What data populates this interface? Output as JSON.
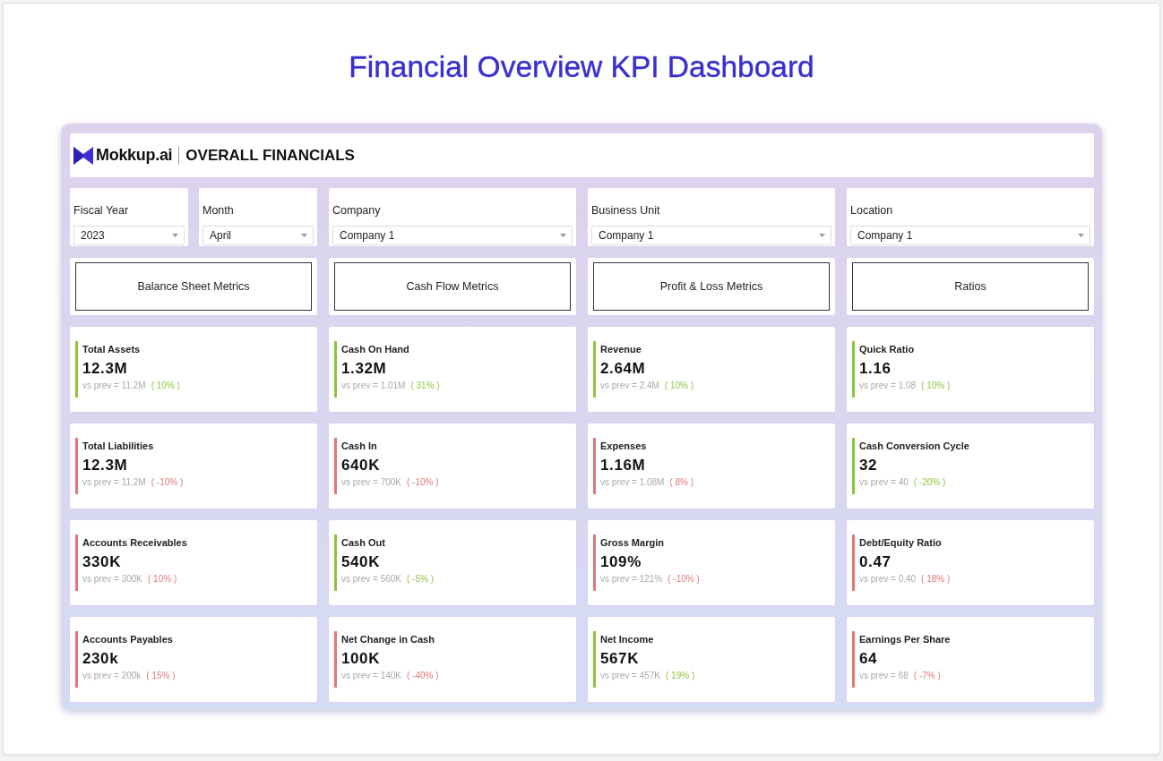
{
  "page_title": "Financial Overview KPI Dashboard",
  "header": {
    "brand": "Mokkup.ai",
    "title": "OVERALL FINANCIALS"
  },
  "filter_columns": [
    [
      {
        "label": "Fiscal Year",
        "value": "2023"
      },
      {
        "label": "Month",
        "value": "April"
      }
    ],
    [
      {
        "label": "Company",
        "value": "Company 1"
      }
    ],
    [
      {
        "label": "Business Unit",
        "value": "Company 1"
      }
    ],
    [
      {
        "label": "Location",
        "value": "Company 1"
      }
    ]
  ],
  "sections": [
    {
      "label": "Balance Sheet Metrics",
      "metrics": [
        {
          "name": "Total Assets",
          "value": "12.3M",
          "comparison": "vs prev = 11.2M",
          "change": "( 10% )",
          "color": "#8cc63f"
        },
        {
          "name": "Total Liabilities",
          "value": "12.3M",
          "comparison": "vs prev = 11.2M",
          "change": "( -10% )",
          "color": "#e07878"
        },
        {
          "name": "Accounts Receivables",
          "value": "330K",
          "comparison": "vs prev = 300K",
          "change": "( 10% )",
          "color": "#e07878"
        },
        {
          "name": "Accounts Payables",
          "value": "230k",
          "comparison": "vs prev = 200k",
          "change": "( 15% )",
          "color": "#e07878"
        }
      ]
    },
    {
      "label": "Cash Flow Metrics",
      "metrics": [
        {
          "name": "Cash On Hand",
          "value": "1.32M",
          "comparison": "vs prev = 1.01M",
          "change": "( 31% )",
          "color": "#8cc63f"
        },
        {
          "name": "Cash In",
          "value": "640K",
          "comparison": "vs prev = 700K",
          "change": "( -10% )",
          "color": "#e07878"
        },
        {
          "name": "Cash Out",
          "value": "540K",
          "comparison": "vs prev = 560K",
          "change": "( -5% )",
          "color": "#8cc63f"
        },
        {
          "name": "Net Change in Cash",
          "value": "100K",
          "comparison": "vs prev = 140K",
          "change": "( -40% )",
          "color": "#e07878"
        }
      ]
    },
    {
      "label": "Profit & Loss Metrics",
      "metrics": [
        {
          "name": "Revenue",
          "value": "2.64M",
          "comparison": "vs prev = 2.4M",
          "change": "( 10% )",
          "color": "#8cc63f"
        },
        {
          "name": "Expenses",
          "value": "1.16M",
          "comparison": "vs prev = 1.08M",
          "change": "( 8% )",
          "color": "#e07878"
        },
        {
          "name": "Gross Margin",
          "value": "109%",
          "comparison": "vs prev = 121%",
          "change": "( -10% )",
          "color": "#e07878"
        },
        {
          "name": "Net Income",
          "value": "567K",
          "comparison": "vs prev = 457K",
          "change": "( 19% )",
          "color": "#8cc63f"
        }
      ]
    },
    {
      "label": "Ratios",
      "metrics": [
        {
          "name": "Quick Ratio",
          "value": "1.16",
          "comparison": "vs prev = 1.08",
          "change": "( 10% )",
          "color": "#8cc63f"
        },
        {
          "name": "Cash Conversion Cycle",
          "value": "32",
          "comparison": "vs prev = 40",
          "change": "( -20% )",
          "color": "#8cc63f"
        },
        {
          "name": "Debt/Equity Ratio",
          "value": "0.47",
          "comparison": "vs prev = 0.40",
          "change": "( 18% )",
          "color": "#e07878"
        },
        {
          "name": "Earnings Per Share",
          "value": "64",
          "comparison": "vs prev = 68",
          "change": "( -7% )",
          "color": "#e07878"
        }
      ]
    }
  ]
}
